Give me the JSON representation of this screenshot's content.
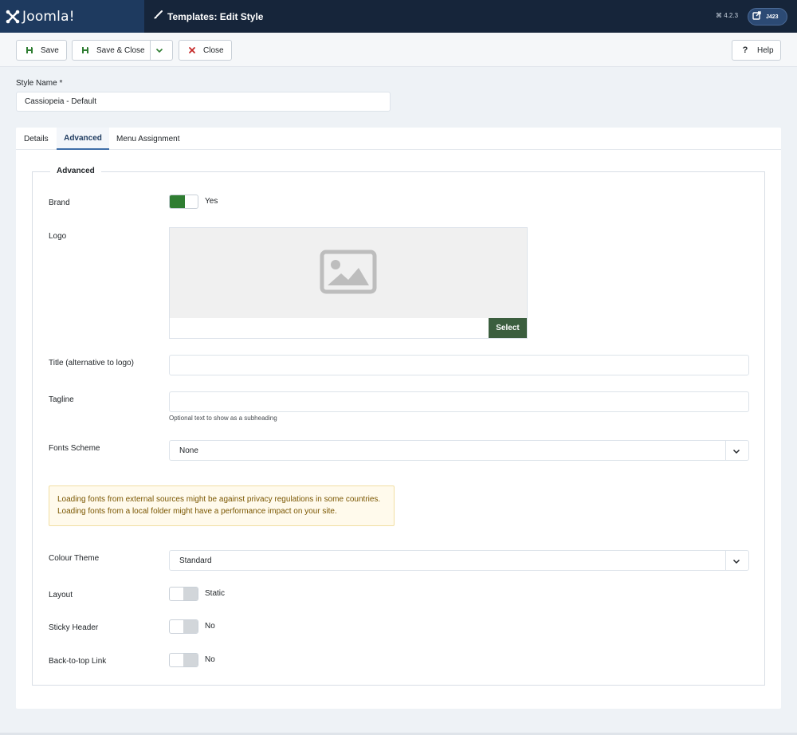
{
  "header": {
    "logo_text": "Joomla!",
    "page_title": "Templates: Edit Style",
    "version": "⌘ 4.2.3",
    "user_label": "J423",
    "colors": {
      "bar": "#16253a",
      "brand": "#1e3a5f"
    }
  },
  "toolbar": {
    "save_label": "Save",
    "save_close_label": "Save & Close",
    "close_label": "Close",
    "help_label": "Help"
  },
  "style_name": {
    "label": "Style Name *",
    "value": "Cassiopeia - Default"
  },
  "tabs": [
    {
      "label": "Details",
      "active": false
    },
    {
      "label": "Advanced",
      "active": true
    },
    {
      "label": "Menu Assignment",
      "active": false
    }
  ],
  "advanced": {
    "legend": "Advanced",
    "brand": {
      "label": "Brand",
      "state": "Yes",
      "on": true
    },
    "logo": {
      "label": "Logo",
      "select_label": "Select",
      "path": ""
    },
    "title": {
      "label": "Title (alternative to logo)",
      "value": ""
    },
    "tagline": {
      "label": "Tagline",
      "value": "",
      "hint": "Optional text to show as a subheading"
    },
    "fonts_scheme": {
      "label": "Fonts Scheme",
      "value": "None"
    },
    "alert": {
      "line1": "Loading fonts from external sources might be against privacy regulations in some countries.",
      "line2": "Loading fonts from a local folder might have a performance impact on your site."
    },
    "colour_theme": {
      "label": "Colour Theme",
      "value": "Standard"
    },
    "layout": {
      "label": "Layout",
      "state": "Static",
      "on": false
    },
    "sticky_header": {
      "label": "Sticky Header",
      "state": "No",
      "on": false
    },
    "back_to_top": {
      "label": "Back-to-top Link",
      "state": "No",
      "on": false
    }
  },
  "colors": {
    "accent_green": "#2f7d32",
    "select_button": "#3b5e3e",
    "tab_active": "#1e3a5f",
    "alert_bg": "#fffaec",
    "alert_text": "#7a5600"
  },
  "icons": [
    "joomla-logo-icon",
    "brush-icon",
    "external-link-icon",
    "save-icon",
    "chevron-down-icon",
    "close-icon",
    "help-icon",
    "image-placeholder-icon"
  ]
}
